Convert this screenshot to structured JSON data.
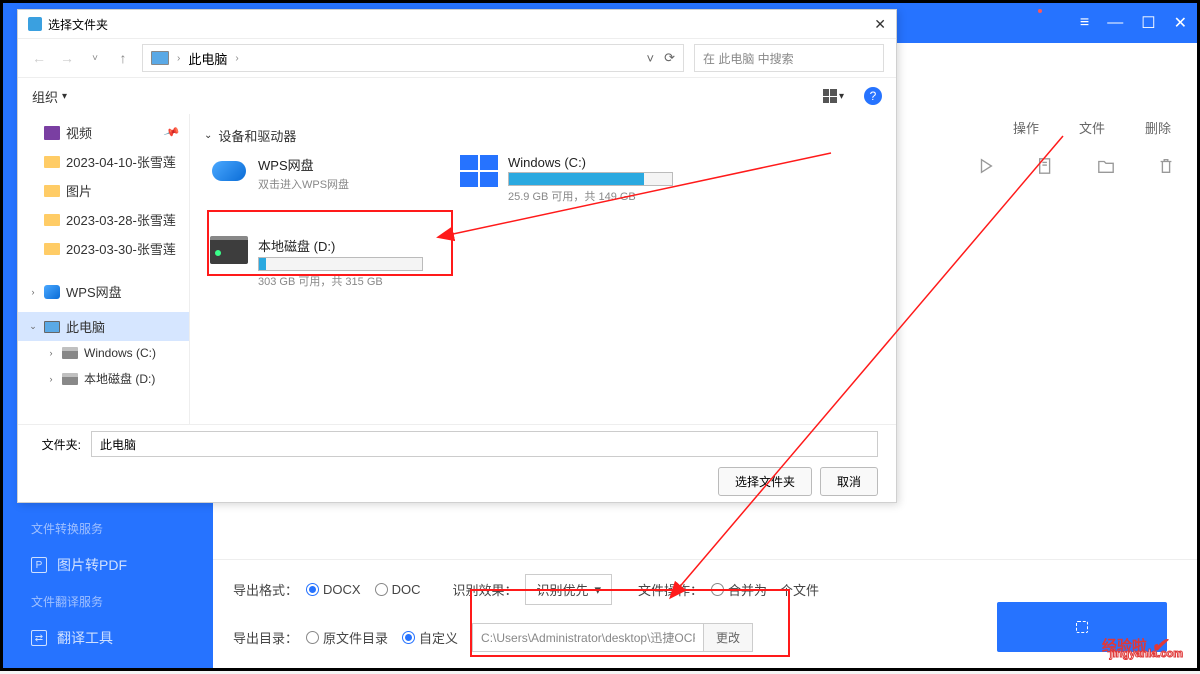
{
  "bg": {
    "columns": {
      "op": "操作",
      "file": "文件",
      "del": "删除"
    }
  },
  "sidebar": {
    "service1": "文件转换服务",
    "item1": "图片转PDF",
    "service2": "文件翻译服务",
    "item2": "翻译工具"
  },
  "bottom": {
    "export_format_label": "导出格式：",
    "docx": "DOCX",
    "doc": "DOC",
    "recog_label": "识别效果：",
    "recog_sel": "识别优先",
    "fileop_label": "文件操作：",
    "fileop_opt": "合并为一个文件",
    "export_dir_label": "导出目录：",
    "origdir": "原文件目录",
    "custom": "自定义",
    "path": "C:\\Users\\Administrator\\desktop\\迅捷OCR文",
    "change": "更改"
  },
  "dialog": {
    "title": "选择文件夹",
    "crumb": "此电脑",
    "search_placeholder": "在 此电脑 中搜索",
    "organize": "组织",
    "tree": {
      "video": "视频",
      "f1": "2023-04-10-张雪莲",
      "pic": "图片",
      "f2": "2023-03-28-张雪莲",
      "f3": "2023-03-30-张雪莲",
      "wps": "WPS网盘",
      "thispc": "此电脑",
      "cdrive": "Windows (C:)",
      "ddrive": "本地磁盘 (D:)"
    },
    "section": "设备和驱动器",
    "wps": {
      "name": "WPS网盘",
      "sub": "双击进入WPS网盘"
    },
    "cdrive": {
      "name": "Windows (C:)",
      "sub": "25.9 GB 可用，共 149 GB"
    },
    "ddrive": {
      "name": "本地磁盘 (D:)",
      "sub": "303 GB 可用，共 315 GB"
    },
    "folder_label": "文件夹:",
    "folder_value": "此电脑",
    "ok": "选择文件夹",
    "cancel": "取消"
  },
  "watermark": {
    "t1": "经验啦",
    "t2": "jingyanla.com"
  }
}
